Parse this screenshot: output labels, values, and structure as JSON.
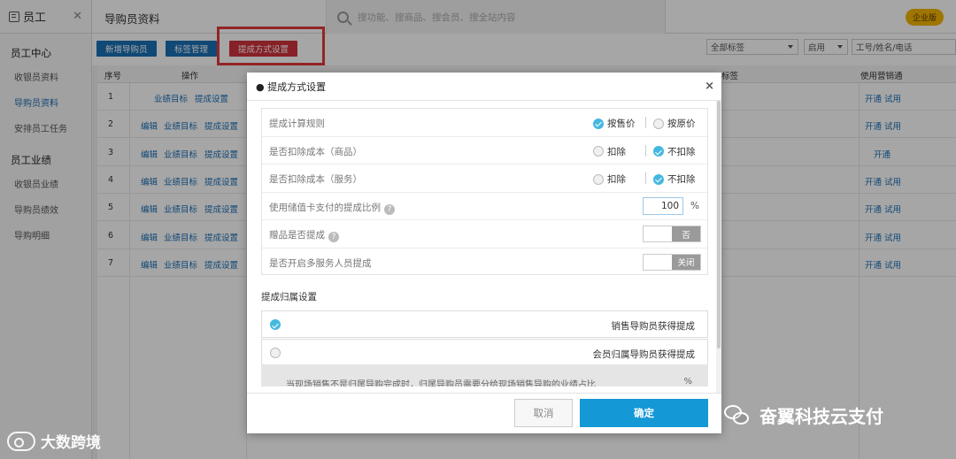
{
  "sidebar": {
    "title": "员工",
    "close": "✕",
    "groups": [
      {
        "label": "员工中心",
        "items": [
          "收银员资料",
          "导购员资料",
          "安排员工任务"
        ]
      },
      {
        "label": "员工业绩",
        "items": [
          "收银员业绩",
          "导购员绩效",
          "导购明细"
        ]
      }
    ]
  },
  "topbar": {
    "page_title": "导购员资料",
    "search_placeholder": "搜功能、搜商品、搜会员、搜全站内容",
    "edition_badge": "企业版"
  },
  "toolbar": {
    "add_guide": "新增导购员",
    "tag_manage": "标签管理",
    "commission_setting": "提成方式设置",
    "filter_tags": "全部标签",
    "filter_status": "启用",
    "filter_search_placeholder": "工号/姓名/电话"
  },
  "table": {
    "headers": {
      "no": "序号",
      "ops": "操作",
      "tag": "标签",
      "sales_channel": "使用营销通"
    },
    "rows": [
      {
        "no": "1",
        "ops": [
          "业绩目标",
          "提成设置"
        ],
        "right": [
          "开通",
          "试用"
        ]
      },
      {
        "no": "2",
        "ops": [
          "编辑",
          "业绩目标",
          "提成设置"
        ],
        "right": [
          "开通",
          "试用"
        ]
      },
      {
        "no": "3",
        "ops": [
          "编辑",
          "业绩目标",
          "提成设置"
        ],
        "right": [
          "开通"
        ]
      },
      {
        "no": "4",
        "ops": [
          "编辑",
          "业绩目标",
          "提成设置"
        ],
        "right": [
          "开通",
          "试用"
        ]
      },
      {
        "no": "5",
        "ops": [
          "编辑",
          "业绩目标",
          "提成设置"
        ],
        "right": [
          "开通",
          "试用"
        ]
      },
      {
        "no": "6",
        "ops": [
          "编辑",
          "业绩目标",
          "提成设置"
        ],
        "right": [
          "开通",
          "试用"
        ]
      },
      {
        "no": "7",
        "ops": [
          "编辑",
          "业绩目标",
          "提成设置"
        ],
        "right": [
          "开通",
          "试用"
        ]
      }
    ]
  },
  "modal": {
    "title": "● 提成方式设置",
    "close": "×",
    "rules": {
      "calc_rule": {
        "label": "提成计算规则",
        "opt_a": "按售价",
        "opt_b": "按原价",
        "selected": "a"
      },
      "deduct_goods": {
        "label": "是否扣除成本（商品）",
        "opt_a": "扣除",
        "opt_b": "不扣除",
        "selected": "b"
      },
      "deduct_service": {
        "label": "是否扣除成本（服务）",
        "opt_a": "扣除",
        "opt_b": "不扣除",
        "selected": "b"
      },
      "stored_card": {
        "label": "使用储值卡支付的提成比例",
        "value": "100",
        "unit": "%"
      },
      "gift": {
        "label": "赠品是否提成",
        "toggle": "否"
      },
      "multi_staff": {
        "label": "是否开启多服务人员提成",
        "toggle": "关闭"
      }
    },
    "attribution": {
      "title": "提成归属设置",
      "opt_sales": "销售导购员获得提成",
      "opt_member": "会员归属导购员获得提成",
      "note": "当现场销售不是归属导购完成时，归属导购员需要分给现场销售导购的业绩占比",
      "note_unit": "%"
    },
    "cancel": "取消",
    "confirm": "确定"
  },
  "watermarks": {
    "left": "大数跨境",
    "right": "奋翼科技云支付"
  }
}
